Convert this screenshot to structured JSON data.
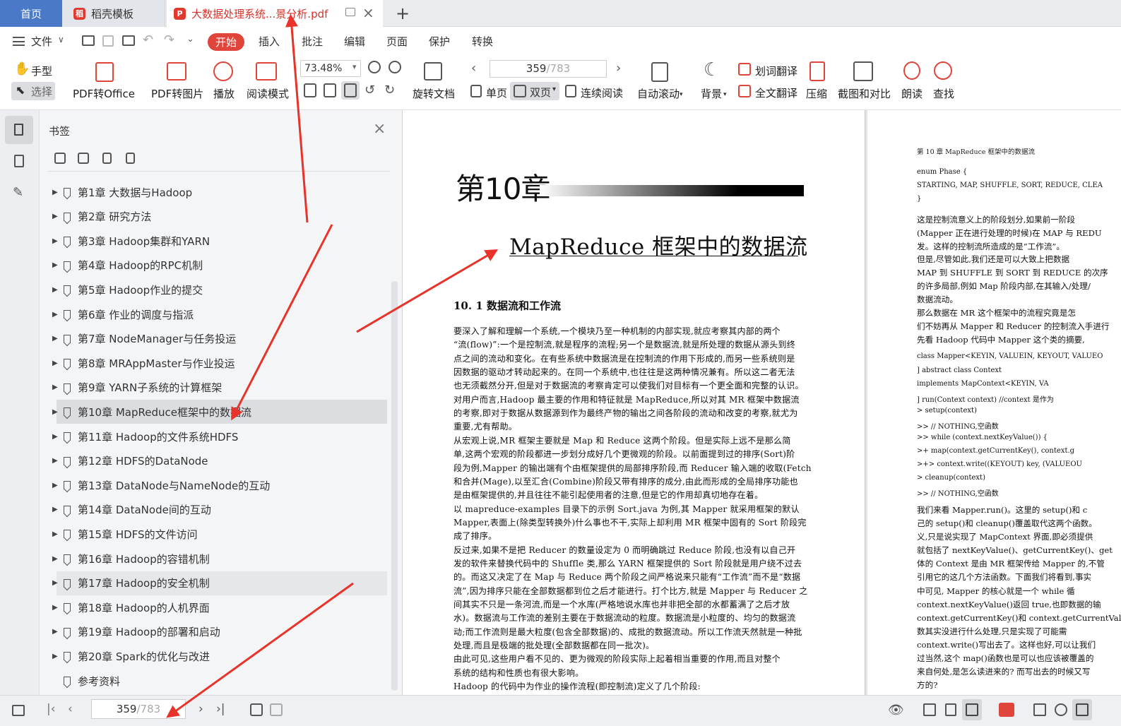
{
  "tabs": {
    "home": "首页",
    "template": "稻壳模板",
    "pdf": "大数据处理系统...景分析.pdf",
    "pdf_badge": "P",
    "template_badge": "稻"
  },
  "menus": {
    "file": "文件",
    "start": "开始",
    "insert": "插入",
    "annotate": "批注",
    "edit": "编辑",
    "page": "页面",
    "protect": "保护",
    "convert": "转换"
  },
  "toolbar": {
    "hand": "手型",
    "select": "选择",
    "pdf_to_office": "PDF转Office",
    "pdf_to_image": "PDF转图片",
    "play": "播放",
    "read_mode": "阅读模式",
    "zoom": "73.48%",
    "rotate_doc": "旋转文档",
    "page_input": "359",
    "page_total": "/783",
    "single_page": "单页",
    "double_page": "双页",
    "continuous": "连续阅读",
    "auto_scroll": "自动滚动",
    "background": "背景",
    "word_translate": "划词翻译",
    "full_translate": "全文翻译",
    "compress": "压缩",
    "screenshot_compare": "截图和对比",
    "read_aloud": "朗读",
    "find": "查找"
  },
  "panel": {
    "title": "书签",
    "bookmarks": [
      {
        "label": "第1章  大数据与Hadoop"
      },
      {
        "label": "第2章  研究方法"
      },
      {
        "label": "第3章  Hadoop集群和YARN"
      },
      {
        "label": "第4章  Hadoop的RPC机制"
      },
      {
        "label": "第5章  Hadoop作业的提交"
      },
      {
        "label": "第6章  作业的调度与指派"
      },
      {
        "label": "第7章  NodeManager与任务投运"
      },
      {
        "label": "第8章  MRAppMaster与作业投运"
      },
      {
        "label": "第9章  YARN子系统的计算框架"
      },
      {
        "label": "第10章  MapReduce框架中的数据流"
      },
      {
        "label": "第11章  Hadoop的文件系统HDFS"
      },
      {
        "label": "第12章  HDFS的DataNode"
      },
      {
        "label": "第13章  DataNode与NameNode的互动"
      },
      {
        "label": "第14章  DataNode间的互动"
      },
      {
        "label": "第15章  HDFS的文件访问"
      },
      {
        "label": "第16章  Hadoop的容错机制"
      },
      {
        "label": "第17章  Hadoop的安全机制"
      },
      {
        "label": "第18章  Hadoop的人机界面"
      },
      {
        "label": "第19章  Hadoop的部署和启动"
      },
      {
        "label": "第20章  Spark的优化与改进"
      },
      {
        "label": "参考资料"
      }
    ]
  },
  "page_left": {
    "chapter": "第10章",
    "title": "MapReduce 框架中的数据流",
    "section": "10. 1    数据流和工作流",
    "lines": [
      "    要深入了解和理解一个系统,一个模块乃至一种机制的内部实现,就应考察其内部的两个",
      "“流(flow)”:一个是控制流,就是程序的流程;另一个是数据流,就是所处理的数据从源头到终",
      "点之间的流动和变化。在有些系统中数据流是在控制流的作用下形成的,而另一些系统则是",
      "因数据的驱动才转动起来的。在同一个系统中,也往往是这两种情况兼有。所以这二者无法",
      "也无须截然分开,但是对于数据流的考察肯定可以使我们对目标有一个更全面和完整的认识。",
      "    对用户而言,Hadoop 最主要的作用和特征就是 MapReduce,所以对其 MR 框架中数据流",
      "的考察,即对于数据从数据源到作为最终产物的输出之间各阶段的流动和改变的考察,就尤为",
      "重要,尤有帮助。",
      "    从宏观上说,MR 框架主要就是 Map 和 Reduce 这两个阶段。但是实际上远不是那么简",
      "单,这两个宏观的阶段都进一步划分成好几个更微观的阶段。以前面提到过的排序(Sort)阶",
      "段为例,Mapper 的输出端有个由框架提供的局部排序阶段,而 Reducer 输入端的收取(Fetch)",
      "和合并(Mage),以至汇合(Combine)阶段又带有排序的成分,由此而形成的全局排序功能也",
      "是由框架提供的,并且往往不能引起使用者的注意,但是它的作用却真切地存在着。",
      "    以 mapreduce-examples 目录下的示例 Sort.java 为例,其 Mapper 就采用框架的默认",
      "Mapper,表面上(除类型转换外)什么事也不干,实际上却利用 MR 框架中固有的 Sort 阶段完",
      "成了排序。",
      "    反过来,如果不是把 Reducer 的数量设定为 0 而明确跳过 Reduce 阶段,也没有以自己开",
      "发的软件来替换代码中的 Shuffle 类,那么 YARN 框架提供的 Sort 阶段就是用户绕不过去",
      "的。而这又决定了在 Map 与 Reduce 两个阶段之间严格说来只能有“工作流”而不是“数据",
      "流”,因为排序只能在全部数据都到位之后才能进行。打个比方,就是 Mapper 与 Reducer 之",
      "间其实不只是一条河流,而是一个水库(严格地说水库也并非把全部的水都蓄满了之后才放",
      "水)。数据流与工作流的差别主要在于数据流动的粒度。数据流是小粒度的、均匀的数据流",
      "动;而工作流则是最大粒度(包含全部数据)的、成批的数据流动。所以工作流天然就是一种批",
      "处理,而且是极端的批处理(全部数据都在同一批次)。",
      "    由此可见,这些用户看不见的、更为微观的阶段实际上起着相当重要的作用,而且对整个",
      "系统的结构和性质也有很大影响。",
      "    Hadoop 的代码中为作业的操作流程(即控制流)定义了几个阶段:"
    ]
  },
  "page_right": {
    "header": "第 10 章    MapReduce 框架中的数据流",
    "lines": [
      "enum Phase {",
      "  STARTING, MAP, SHUFFLE, SORT, REDUCE, CLEA",
      "}",
      "    这是控制流意义上的阶段划分,如果前一阶段",
      "(Mapper 正在进行处理的时候)在 MAP 与 REDU",
      "发。这样的控制流所造成的是“工作流”。",
      "    但是,尽管如此,我们还是可以大致上把数据",
      "MAP 到 SHUFFLE 到 SORT 到 REDUCE 的次序",
      "的许多局部,例如 Map 阶段内部,在其输入/处理/",
      "数据流动。",
      "    那么数据在 MR 这个框架中的流程究竟是怎",
      "们不妨再从 Mapper 和 Reducer 的控制流入手进行",
      "    先看 Hadoop 代码中 Mapper 这个类的摘要,",
      "class Mapper<KEYIN, VALUEIN, KEYOUT, VALUEO",
      "] abstract class Context",
      "          implements MapContext<KEYIN, VA",
      "] run(Context context)      //context 是作为",
      "  > setup(context)",
      "  >> // NOTHING,空函数",
      "  >> while (context.nextKeyValue()) {",
      "  >+ map(context.getCurrentKey(), context.g",
      "  >+> context.write((KEYOUT) key, (VALUEOU",
      "  > cleanup(context)",
      "  >> // NOTHING,空函数",
      "    我们来看 Mapper.run()。这里的 setup()和 c",
      "己的 setup()和 cleanup()覆盖取代这两个函数。",
      "义,只是说实现了 MapContext 界面,即必须提供",
      "就包括了 nextKeyValue()、getCurrentKey()、get",
      "体的 Context 是由 MR 框架传给 Mapper 的,不管",
      "引用它的这几个方法函数。下面我们将看到,事实",
      "中可见, Mapper 的核心就是一个 while 循",
      "context.nextKeyValue()返回 true,也即数据的输",
      "context.getCurrentKey()和 context.getCurrentValue(",
      "数其实没进行什么处理,只是实现了可能需",
      "context.write()写出去了。这样也好,可以让我们",
      "过当然,这个 map()函数也是可以也应该被覆盖的",
      "来自何处,是怎么读进来的? 而写出去的时候又写",
      "方的?"
    ]
  },
  "status": {
    "page_input": "359",
    "page_total": "/783"
  },
  "colors": {
    "accent": "#e0453b",
    "home_tab": "#4a79c8",
    "annotation_arrow": "#e8332b"
  }
}
